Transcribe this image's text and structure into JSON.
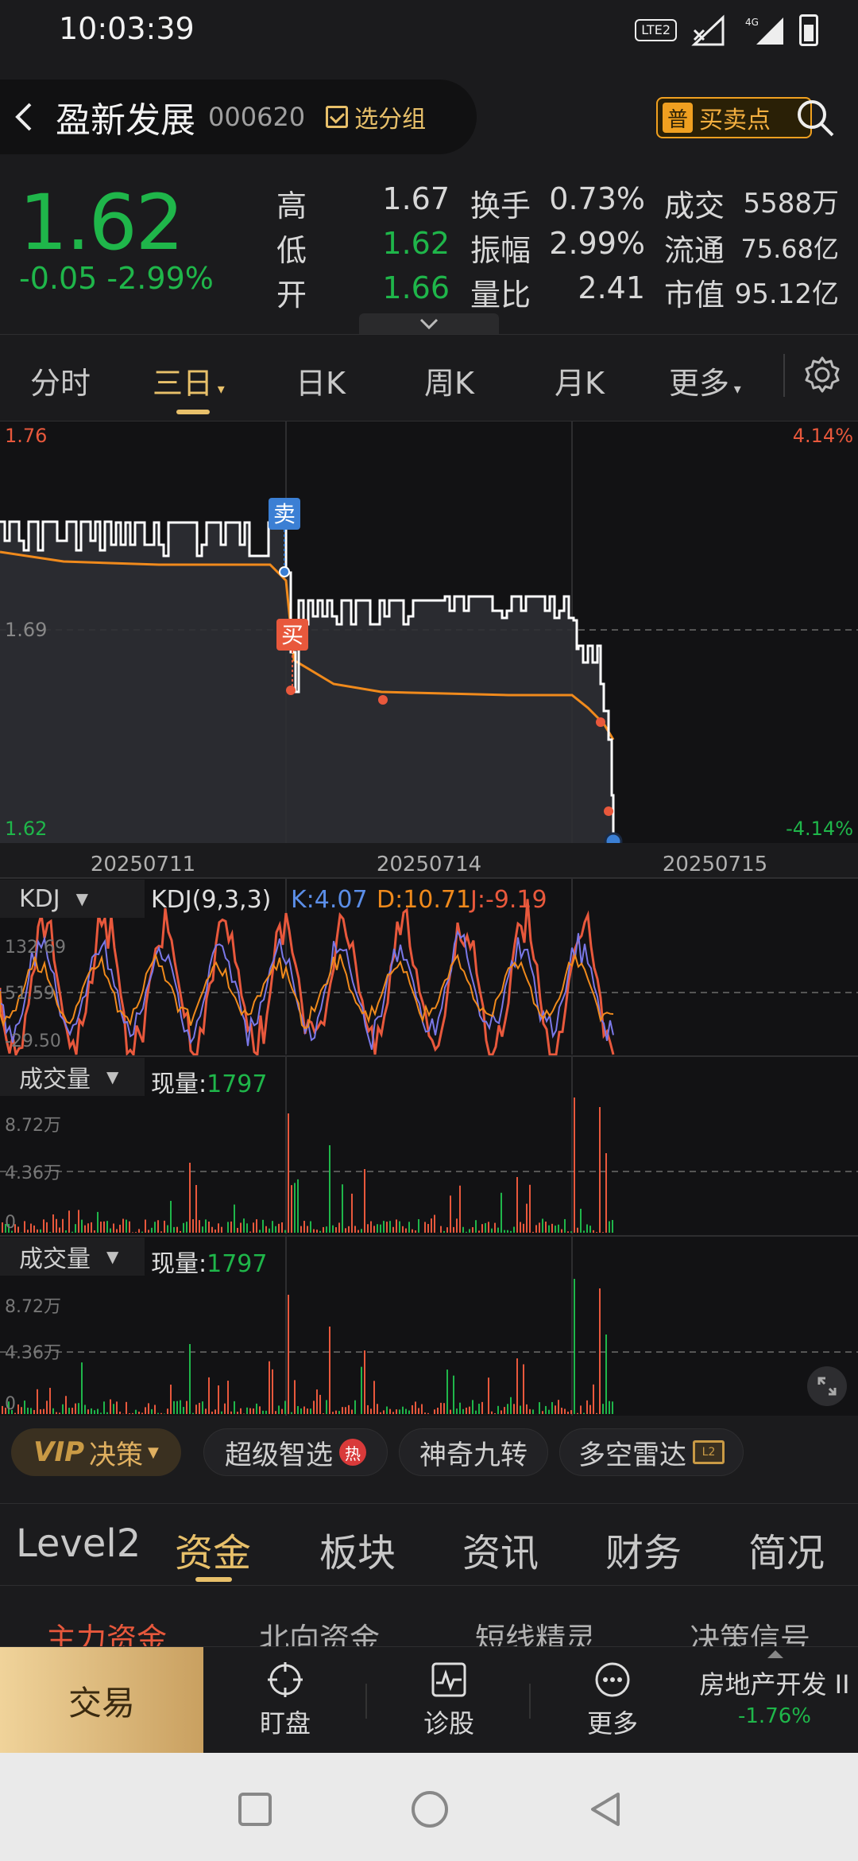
{
  "status_bar": {
    "time": "10:03:39",
    "lte": "LTE2",
    "net": "4G"
  },
  "header": {
    "name": "盈新发展",
    "code": "000620",
    "group_label": "选分组",
    "buysell_badge": "普",
    "buysell_label": "买卖点"
  },
  "quote": {
    "price": "1.62",
    "change": "-0.05",
    "change_pct": "-2.99%",
    "high_label": "高",
    "high": "1.67",
    "low_label": "低",
    "low": "1.62",
    "open_label": "开",
    "open": "1.66",
    "turnover_label": "换手",
    "turnover": "0.73%",
    "amplitude_label": "振幅",
    "amplitude": "2.99%",
    "vol_ratio_label": "量比",
    "vol_ratio": "2.41",
    "amount_label": "成交",
    "amount": "5588万",
    "float_label": "流通",
    "float_cap": "75.68亿",
    "mktcap_label": "市值",
    "mkt_cap": "95.12亿"
  },
  "period_tabs": [
    "分时",
    "三日",
    "日K",
    "周K",
    "月K",
    "更多"
  ],
  "price_chart": {
    "y_top": "1.76",
    "y_mid": "1.69",
    "y_bottom": "1.62",
    "pct_top": "4.14%",
    "pct_bottom": "-4.14%",
    "dates": [
      "20250711",
      "20250714",
      "20250715"
    ],
    "sell_tag": "卖",
    "buy_tag": "买"
  },
  "kdj": {
    "selector": "KDJ",
    "params": "KDJ(9,3,3)",
    "k_label": "K:4.07",
    "d_label": "D:10.71",
    "j_label": "J:-9.19",
    "y_top": "132.69",
    "y_mid": "51.59",
    "y_bottom": "-29.50"
  },
  "volume1": {
    "selector": "成交量",
    "now_label": "现量:",
    "now_value": "1797",
    "y_top": "8.72万",
    "y_mid": "4.36万",
    "y_zero": "0"
  },
  "volume2": {
    "selector": "成交量",
    "now_label": "现量:",
    "now_value": "1797",
    "y_top": "8.72万",
    "y_mid": "4.36万",
    "y_zero": "0"
  },
  "pills": {
    "vip_v": "VIP",
    "vip_label": "决策",
    "p1": "超级智选",
    "hot": "热",
    "p2": "神奇九转",
    "p3": "多空雷达",
    "l2": "L2"
  },
  "bottom_tabs": [
    "Level2",
    "资金",
    "板块",
    "资讯",
    "财务",
    "简况"
  ],
  "sub_tabs": [
    "主力资金",
    "北向资金",
    "短线精灵",
    "决策信号"
  ],
  "action_bar": {
    "trade": "交易",
    "watch": "盯盘",
    "diagnose": "诊股",
    "more": "更多",
    "sector_name": "房地产开发 II",
    "sector_pct": "-1.76%"
  },
  "colors": {
    "up": "#e8583c",
    "down": "#1fb64a",
    "accent": "#e8c06a",
    "k_line": "#4a7fd8",
    "d_line": "#f08a1c",
    "j_line": "#e8583c",
    "price_line": "#ffffff",
    "avg_line": "#f08a1c"
  }
}
